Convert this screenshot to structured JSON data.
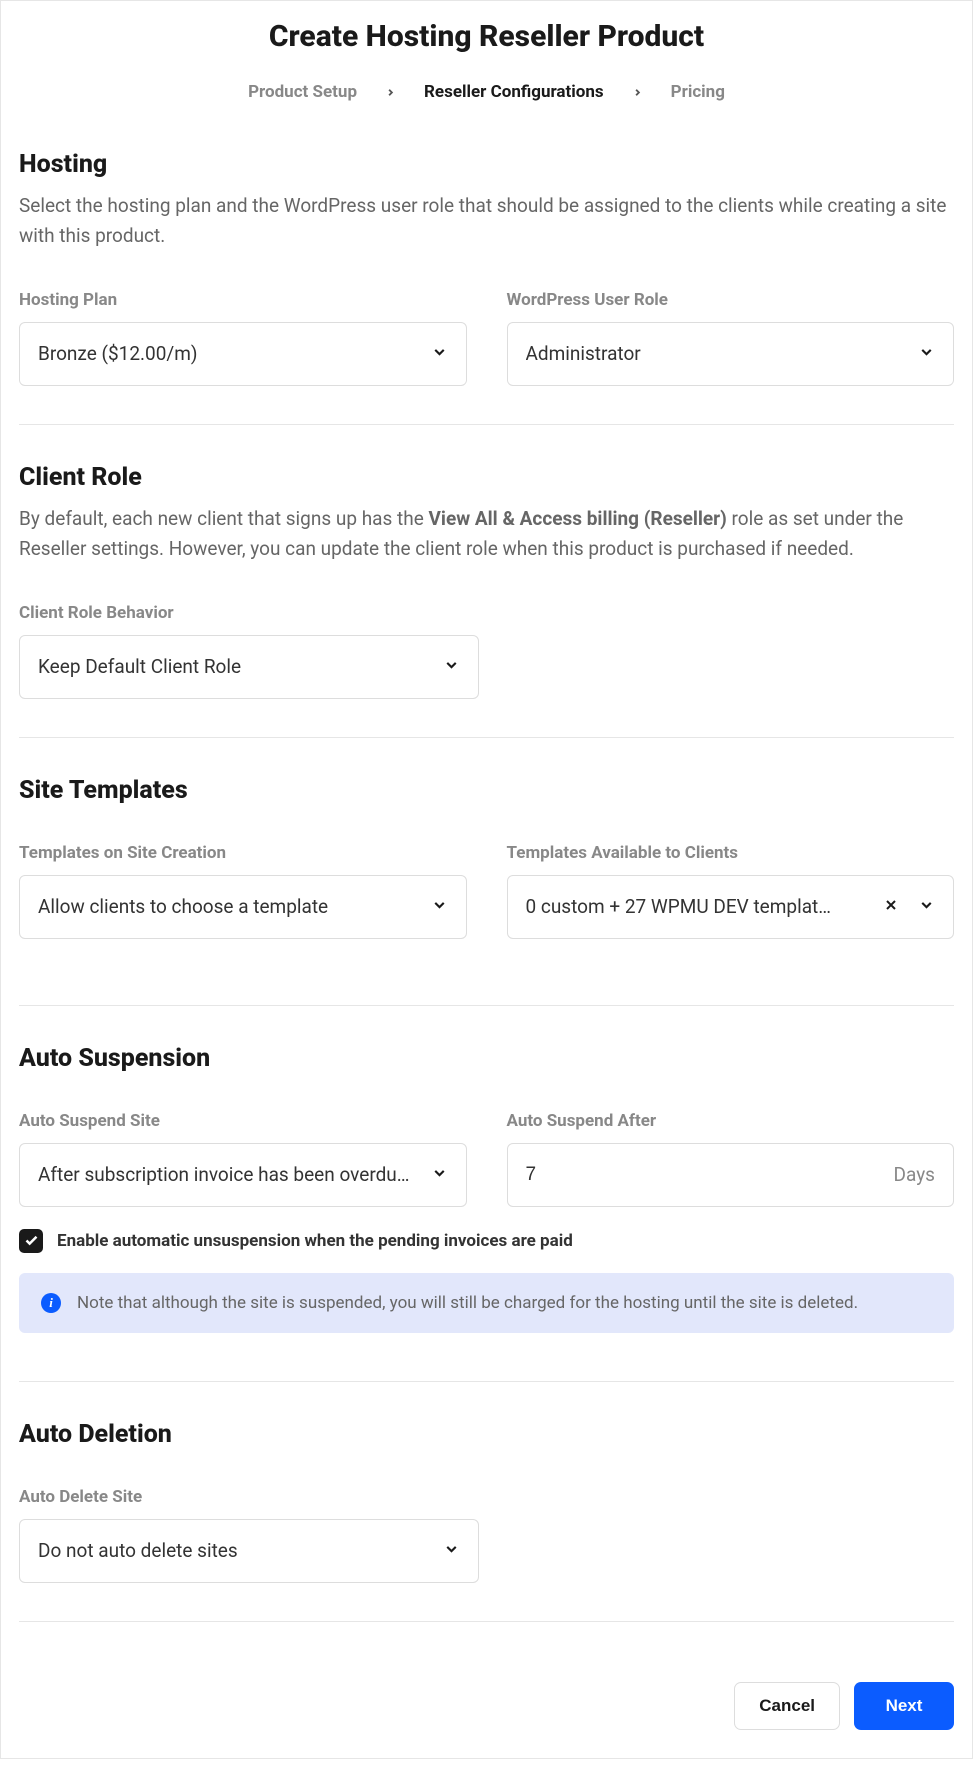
{
  "page_title": "Create Hosting Reseller Product",
  "breadcrumb": {
    "step1": "Product Setup",
    "step2": "Reseller Configurations",
    "step3": "Pricing"
  },
  "hosting": {
    "title": "Hosting",
    "desc": "Select the hosting plan and the WordPress user role that should be assigned to the clients while creating a site with this product.",
    "plan_label": "Hosting Plan",
    "plan_value": "Bronze ($12.00/m)",
    "role_label": "WordPress User Role",
    "role_value": "Administrator"
  },
  "client_role": {
    "title": "Client Role",
    "desc_prefix": "By default, each new client that signs up has the ",
    "desc_bold": "View All & Access billing (Reseller)",
    "desc_suffix": " role as set under the Reseller settings. However, you can update the client role when this product is purchased if needed.",
    "behavior_label": "Client Role Behavior",
    "behavior_value": "Keep Default Client Role"
  },
  "site_templates": {
    "title": "Site Templates",
    "creation_label": "Templates on Site Creation",
    "creation_value": "Allow clients to choose a template",
    "available_label": "Templates Available to Clients",
    "available_value": "0 custom + 27 WPMU DEV templat…"
  },
  "auto_suspension": {
    "title": "Auto Suspension",
    "suspend_label": "Auto Suspend Site",
    "suspend_value": "After subscription invoice has been overdu…",
    "after_label": "Auto Suspend After",
    "after_value": "7",
    "after_suffix": "Days",
    "checkbox_label": "Enable automatic unsuspension when the pending invoices are paid",
    "notice": "Note that although the site is suspended, you will still be charged for the hosting until the site is deleted."
  },
  "auto_deletion": {
    "title": "Auto Deletion",
    "delete_label": "Auto Delete Site",
    "delete_value": "Do not auto delete sites"
  },
  "actions": {
    "cancel": "Cancel",
    "next": "Next"
  }
}
